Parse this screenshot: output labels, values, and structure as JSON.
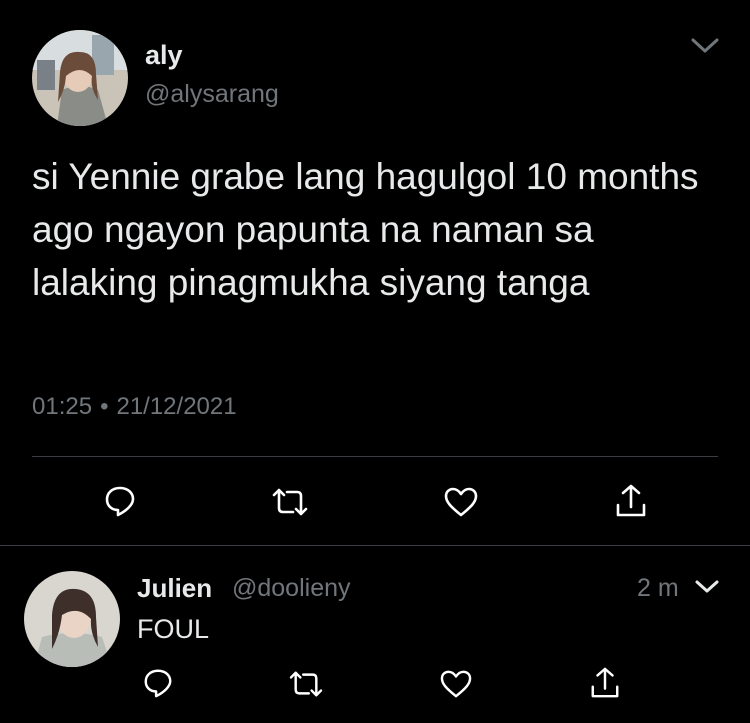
{
  "tweet": {
    "author_name": "aly",
    "author_handle": "@alysarang",
    "text": "si Yennie grabe lang hagulgol 10 months ago ngayon papunta na naman sa lalaking pinagmukha siyang tanga",
    "time": "01:25",
    "separator": "•",
    "date": "21/12/2021",
    "icons": [
      "reply-icon",
      "retweet-icon",
      "like-icon",
      "share-icon",
      "chevron-down-icon"
    ]
  },
  "reply": {
    "author_name": "Julien",
    "author_handle": "@doolieny",
    "time": "2 m",
    "text": "FOUL",
    "icons": [
      "reply-icon",
      "retweet-icon",
      "like-icon",
      "share-icon",
      "chevron-down-icon"
    ]
  },
  "colors": {
    "background": "#000000",
    "text": "#e7e9ea",
    "secondary": "#71767b",
    "divider": "#3a3d41",
    "icon": "#ffffff"
  }
}
